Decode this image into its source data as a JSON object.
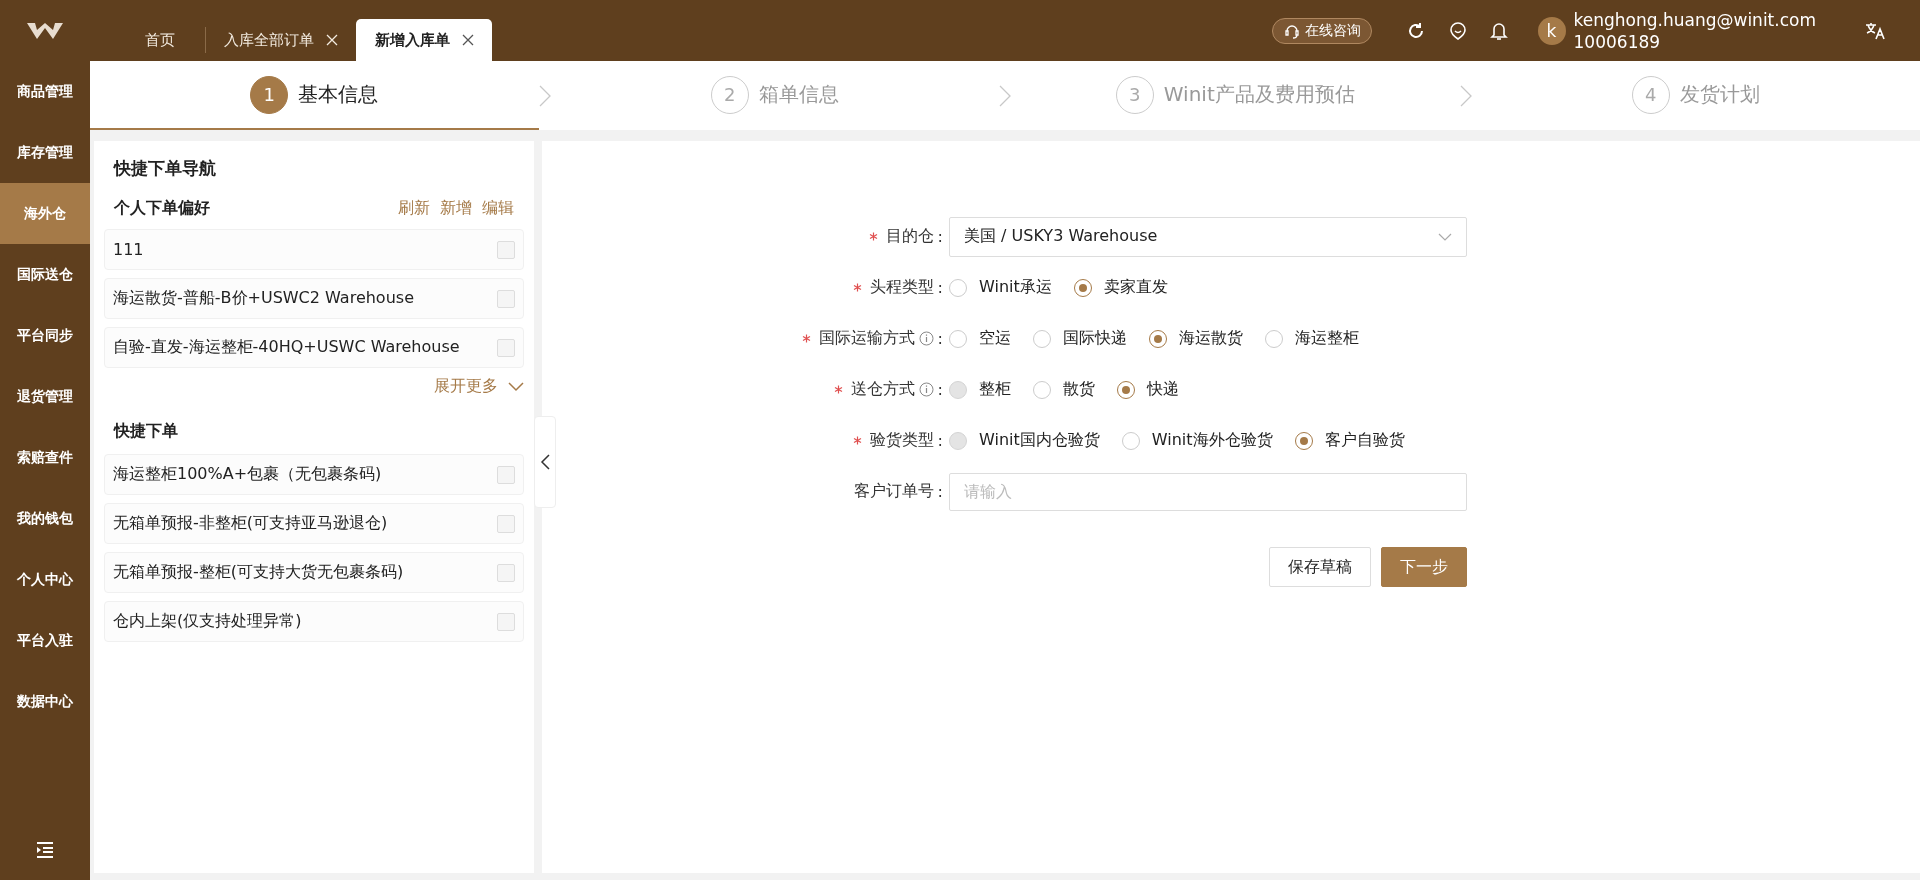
{
  "header": {
    "tabs": [
      {
        "label": "首页",
        "selected": false,
        "closable": false
      },
      {
        "label": "入库全部订单",
        "selected": false,
        "closable": true
      },
      {
        "label": "新增入库单",
        "selected": true,
        "closable": true
      }
    ],
    "consult_button": "在线咨询",
    "user": {
      "avatar": "k",
      "email": "kenghong.huang@winit.com",
      "id": "10006189"
    }
  },
  "sidebar": {
    "items": [
      {
        "label": "商品管理",
        "selected": false
      },
      {
        "label": "库存管理",
        "selected": false
      },
      {
        "label": "海外仓",
        "selected": true
      },
      {
        "label": "国际送仓",
        "selected": false
      },
      {
        "label": "平台同步",
        "selected": false
      },
      {
        "label": "退货管理",
        "selected": false
      },
      {
        "label": "索赔查件",
        "selected": false
      },
      {
        "label": "我的钱包",
        "selected": false
      },
      {
        "label": "个人中心",
        "selected": false
      },
      {
        "label": "平台入驻",
        "selected": false
      },
      {
        "label": "数据中心",
        "selected": false
      }
    ]
  },
  "steps": [
    {
      "number": "1",
      "label": "基本信息",
      "selected": true
    },
    {
      "number": "2",
      "label": "箱单信息",
      "selected": false
    },
    {
      "number": "3",
      "label": "Winit产品及费用预估",
      "selected": false
    },
    {
      "number": "4",
      "label": "发货计划",
      "selected": false
    }
  ],
  "quick_panel": {
    "title": "快捷下单导航",
    "preferences": {
      "title": "个人下单偏好",
      "actions": [
        "刷新",
        "新增",
        "编辑"
      ],
      "items": [
        {
          "label": "111",
          "checked": false
        },
        {
          "label": "海运散货-普船-B价+USWC2 Warehouse",
          "checked": false
        },
        {
          "label": "自验-直发-海运整柜-40HQ+USWC Warehouse",
          "checked": false
        }
      ],
      "expand": "展开更多"
    },
    "quick_orders": {
      "title": "快捷下单",
      "items": [
        {
          "label": "海运整柜100%A+包裹（无包裹条码)",
          "checked": false
        },
        {
          "label": "无箱单预报-非整柜(可支持亚马逊退仓)",
          "checked": false
        },
        {
          "label": "无箱单预报-整柜(可支持大货无包裹条码)",
          "checked": false
        },
        {
          "label": "仓内上架(仅支持处理异常)",
          "checked": false
        }
      ]
    }
  },
  "form": {
    "fields": [
      {
        "kind": "select",
        "label": "目的仓",
        "label_suffix": ":",
        "required": true,
        "info": false,
        "value": "美国 / USKY3 Warehouse"
      },
      {
        "kind": "radio",
        "label": "头程类型",
        "label_suffix": ":",
        "required": true,
        "info": false,
        "options": [
          {
            "label": "Winit承运",
            "selected": false,
            "disabled": false
          },
          {
            "label": "卖家直发",
            "selected": true,
            "disabled": false
          }
        ]
      },
      {
        "kind": "radio",
        "label": "国际运输方式",
        "label_suffix": ":",
        "required": true,
        "info": true,
        "options": [
          {
            "label": "空运",
            "selected": false,
            "disabled": false
          },
          {
            "label": "国际快递",
            "selected": false,
            "disabled": false
          },
          {
            "label": "海运散货",
            "selected": true,
            "disabled": false
          },
          {
            "label": "海运整柜",
            "selected": false,
            "disabled": false
          }
        ]
      },
      {
        "kind": "radio",
        "label": "送仓方式",
        "label_suffix": ":",
        "required": true,
        "info": true,
        "options": [
          {
            "label": "整柜",
            "selected": false,
            "disabled": true
          },
          {
            "label": "散货",
            "selected": false,
            "disabled": false
          },
          {
            "label": "快递",
            "selected": true,
            "disabled": false
          }
        ]
      },
      {
        "kind": "radio",
        "label": "验货类型",
        "label_suffix": ":",
        "required": true,
        "info": false,
        "options": [
          {
            "label": "Winit国内仓验货",
            "selected": false,
            "disabled": true
          },
          {
            "label": "Winit海外仓验货",
            "selected": false,
            "disabled": false
          },
          {
            "label": "客户自验货",
            "selected": true,
            "disabled": false
          }
        ]
      },
      {
        "kind": "text",
        "label": "客户订单号",
        "label_suffix": ":",
        "required": false,
        "info": false,
        "placeholder": "请输入"
      }
    ],
    "buttons": [
      {
        "label": "保存草稿",
        "kind": "secondary"
      },
      {
        "label": "下一步",
        "kind": "primary"
      }
    ]
  }
}
